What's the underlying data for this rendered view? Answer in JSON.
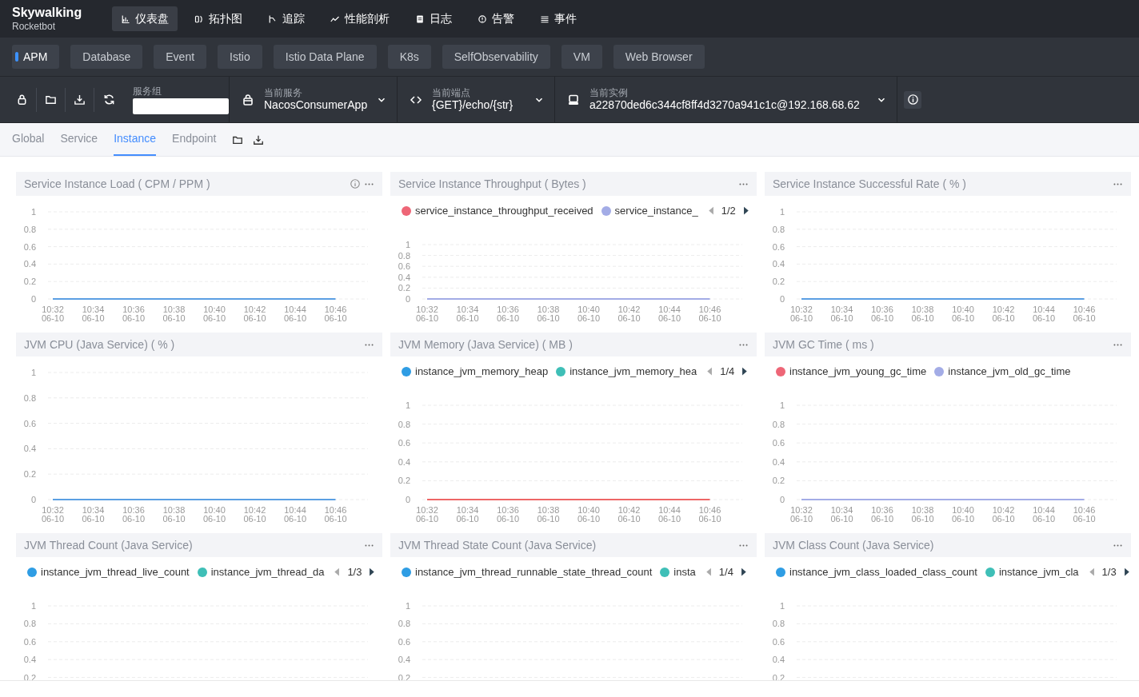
{
  "brand": {
    "name": "Skywalking",
    "subtitle": "Rocketbot"
  },
  "nav": [
    {
      "label": "仪表盘",
      "selected": true
    },
    {
      "label": "拓扑图",
      "selected": false
    },
    {
      "label": "追踪",
      "selected": false
    },
    {
      "label": "性能剖析",
      "selected": false
    },
    {
      "label": "日志",
      "selected": false
    },
    {
      "label": "告警",
      "selected": false
    },
    {
      "label": "事件",
      "selected": false
    }
  ],
  "layers": [
    {
      "label": "APM",
      "selected": true
    },
    {
      "label": "Database",
      "selected": false
    },
    {
      "label": "Event",
      "selected": false
    },
    {
      "label": "Istio",
      "selected": false
    },
    {
      "label": "Istio Data Plane",
      "selected": false
    },
    {
      "label": "K8s",
      "selected": false
    },
    {
      "label": "SelfObservability",
      "selected": false
    },
    {
      "label": "VM",
      "selected": false
    },
    {
      "label": "Web Browser",
      "selected": false
    }
  ],
  "selectors": [
    {
      "kind": "input",
      "label": "服务组"
    },
    {
      "kind": "select",
      "label": "当前服务",
      "value": "NacosConsumerApp"
    },
    {
      "kind": "select",
      "label": "当前端点",
      "value": "{GET}/echo/{str}"
    },
    {
      "kind": "select",
      "label": "当前实例",
      "value": "a22870ded6c344cf8ff4d3270a941c1c@192.168.68.62"
    }
  ],
  "tabs": [
    {
      "label": "Global",
      "selected": false
    },
    {
      "label": "Service",
      "selected": false
    },
    {
      "label": "Instance",
      "selected": true
    },
    {
      "label": "Endpoint",
      "selected": false
    }
  ],
  "panels": [
    {
      "title": "Service Instance Load ( CPM / PPM )",
      "info": true,
      "chart_data": {
        "type": "line",
        "grid": true,
        "categories": [
          "10:32 06-10",
          "10:34 06-10",
          "10:36 06-10",
          "10:38 06-10",
          "10:40 06-10",
          "10:42 06-10",
          "10:44 06-10",
          "10:46 06-10"
        ],
        "ylim": [
          0,
          1
        ],
        "yticks": [
          0,
          0.2,
          0.4,
          0.6,
          0.8,
          1
        ],
        "series": [
          {
            "color": "#5b9fe3",
            "values": [
              0,
              0,
              0,
              0,
              0,
              0,
              0,
              0
            ]
          }
        ]
      }
    },
    {
      "title": "Service Instance Throughput ( Bytes )",
      "pager": "1/2",
      "chart_data": {
        "type": "line",
        "grid": true,
        "categories": [
          "10:32 06-10",
          "10:34 06-10",
          "10:36 06-10",
          "10:38 06-10",
          "10:40 06-10",
          "10:42 06-10",
          "10:44 06-10",
          "10:46 06-10"
        ],
        "ylim": [
          0,
          1
        ],
        "yticks": [
          0,
          0.2,
          0.4,
          0.6,
          0.8,
          1
        ],
        "series": [
          {
            "name": "service_instance_throughput_received",
            "color": "#ee6677",
            "values": [
              null,
              null,
              null,
              null,
              null,
              null,
              null,
              null
            ]
          },
          {
            "name": "service_instance_",
            "color": "#a3ace6",
            "values": [
              0,
              0,
              0,
              0,
              0,
              0,
              0,
              0
            ]
          }
        ]
      }
    },
    {
      "title": "Service Instance Successful Rate ( % )",
      "chart_data": {
        "type": "line",
        "grid": true,
        "categories": [
          "10:32 06-10",
          "10:34 06-10",
          "10:36 06-10",
          "10:38 06-10",
          "10:40 06-10",
          "10:42 06-10",
          "10:44 06-10",
          "10:46 06-10"
        ],
        "ylim": [
          0,
          1
        ],
        "yticks": [
          0,
          0.2,
          0.4,
          0.6,
          0.8,
          1
        ],
        "series": [
          {
            "color": "#5b9fe3",
            "values": [
              0,
              0,
              0,
              0,
              0,
              0,
              0,
              0
            ]
          }
        ]
      }
    },
    {
      "title": "JVM CPU (Java Service) ( % )",
      "chart_data": {
        "type": "line",
        "grid": true,
        "categories": [
          "10:32 06-10",
          "10:34 06-10",
          "10:36 06-10",
          "10:38 06-10",
          "10:40 06-10",
          "10:42 06-10",
          "10:44 06-10",
          "10:46 06-10"
        ],
        "ylim": [
          0,
          1
        ],
        "yticks": [
          0,
          0.2,
          0.4,
          0.6,
          0.8,
          1
        ],
        "series": [
          {
            "color": "#5b9fe3",
            "values": [
              0,
              0,
              0,
              0,
              0,
              0,
              0,
              0
            ]
          }
        ]
      }
    },
    {
      "title": "JVM Memory (Java Service) ( MB )",
      "pager": "1/4",
      "chart_data": {
        "type": "line",
        "grid": true,
        "categories": [
          "10:32 06-10",
          "10:34 06-10",
          "10:36 06-10",
          "10:38 06-10",
          "10:40 06-10",
          "10:42 06-10",
          "10:44 06-10",
          "10:46 06-10"
        ],
        "ylim": [
          0,
          1
        ],
        "yticks": [
          0,
          0.2,
          0.4,
          0.6,
          0.8,
          1
        ],
        "series": [
          {
            "name": "instance_jvm_memory_heap",
            "color": "#2f9de4",
            "values": [
              null,
              null,
              null,
              null,
              null,
              null,
              null,
              null
            ]
          },
          {
            "name": "instance_jvm_memory_hea",
            "color": "#3fbfb7",
            "values": [
              null,
              null,
              null,
              null,
              null,
              null,
              null,
              null
            ]
          },
          {
            "color": "#ee6666",
            "values": [
              0,
              0,
              0,
              0,
              0,
              0,
              0,
              0
            ]
          }
        ]
      }
    },
    {
      "title": "JVM GC Time ( ms )",
      "chart_data": {
        "type": "line",
        "grid": true,
        "categories": [
          "10:32 06-10",
          "10:34 06-10",
          "10:36 06-10",
          "10:38 06-10",
          "10:40 06-10",
          "10:42 06-10",
          "10:44 06-10",
          "10:46 06-10"
        ],
        "ylim": [
          0,
          1
        ],
        "yticks": [
          0,
          0.2,
          0.4,
          0.6,
          0.8,
          1
        ],
        "series": [
          {
            "name": "instance_jvm_young_gc_time",
            "color": "#ee6677",
            "values": [
              null,
              null,
              null,
              null,
              null,
              null,
              null,
              null
            ]
          },
          {
            "name": "instance_jvm_old_gc_time",
            "color": "#a3ace6",
            "values": [
              0,
              0,
              0,
              0,
              0,
              0,
              0,
              0
            ]
          }
        ]
      }
    },
    {
      "title": "JVM Thread Count (Java Service)",
      "pager": "1/3",
      "chart_data": {
        "type": "line",
        "grid": true,
        "ylim": [
          0.2,
          1
        ],
        "yticks": [
          0.2,
          0.4,
          0.6,
          0.8,
          1
        ],
        "series": [
          {
            "name": "instance_jvm_thread_live_count",
            "color": "#2f9de4"
          },
          {
            "name": "instance_jvm_thread_da",
            "color": "#3fbfb7"
          }
        ]
      }
    },
    {
      "title": "JVM Thread State Count (Java Service)",
      "pager": "1/4",
      "chart_data": {
        "type": "line",
        "grid": true,
        "ylim": [
          0.2,
          1
        ],
        "yticks": [
          0.2,
          0.4,
          0.6,
          0.8,
          1
        ],
        "series": [
          {
            "name": "instance_jvm_thread_runnable_state_thread_count",
            "color": "#2f9de4"
          },
          {
            "name": "insta",
            "color": "#3fbfb7"
          }
        ]
      }
    },
    {
      "title": "JVM Class Count (Java Service)",
      "pager": "1/3",
      "chart_data": {
        "type": "line",
        "grid": true,
        "ylim": [
          0.2,
          1
        ],
        "yticks": [
          0.2,
          0.4,
          0.6,
          0.8,
          1
        ],
        "series": [
          {
            "name": "instance_jvm_class_loaded_class_count",
            "color": "#2f9de4"
          },
          {
            "name": "instance_jvm_cla",
            "color": "#3fbfb7"
          }
        ]
      }
    }
  ]
}
